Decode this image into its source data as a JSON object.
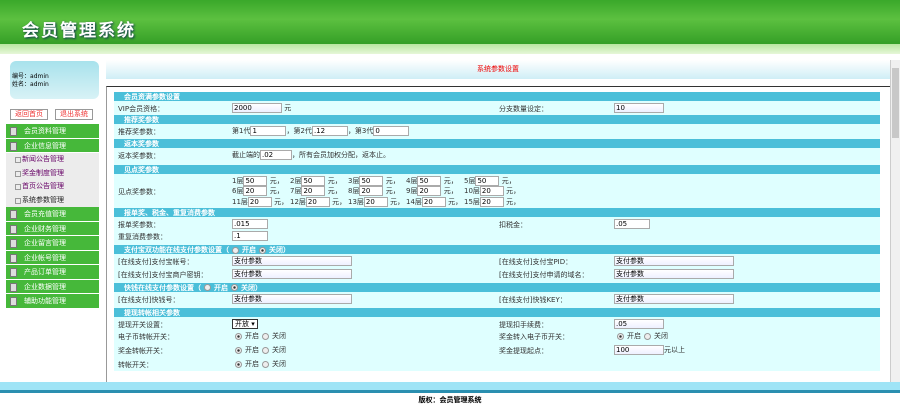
{
  "header": {
    "title": "会员管理系统"
  },
  "user": {
    "id_label": "编号：",
    "id": "admin",
    "name_label": "姓名：",
    "name": "admin"
  },
  "buttons": {
    "home": "返回首页",
    "logout": "退出系统"
  },
  "menu": [
    {
      "label": "会员资料管理"
    },
    {
      "label": "企业信息管理",
      "children": [
        "新闻公告管理",
        "奖金制度管理",
        "首页公告管理",
        "系统参数管理"
      ]
    },
    {
      "label": "会员充值管理"
    },
    {
      "label": "企业财务管理"
    },
    {
      "label": "企业留言管理"
    },
    {
      "label": "企业帐号管理"
    },
    {
      "label": "产品订单管理"
    },
    {
      "label": "企业数据管理"
    },
    {
      "label": "辅助功能管理"
    }
  ],
  "page_title": "系统参数设置",
  "form": {
    "s1": "会员资满参数设置",
    "vip_label": "VIP会员资格：",
    "vip": "2000",
    "yuan": "元",
    "branch_label": "分支数量设定：",
    "branch": "10",
    "s2": "推荐奖参数",
    "rec_label": "推荐奖参数：",
    "g1": "第1代",
    "g1v": "1",
    "g2": "，第2代",
    "g2v": ".12",
    "g3": "，第3代",
    "g3v": "0",
    "s3": "返本奖参数",
    "ret_label": "返本奖参数：",
    "ret_pre": "截止端的",
    "ret_v": ".02",
    "ret_post": "，所有会员加权分配，返本止。",
    "s4": "见点奖参数",
    "pt_label": "见点奖参数：",
    "layers": [
      [
        "1层",
        "50"
      ],
      [
        "2层",
        "50"
      ],
      [
        "3层",
        "50"
      ],
      [
        "4层",
        "50"
      ],
      [
        "5层",
        "50"
      ],
      [
        "6层",
        "20"
      ],
      [
        "7层",
        "20"
      ],
      [
        "8层",
        "20"
      ],
      [
        "9层",
        "20"
      ],
      [
        "10层",
        "20"
      ],
      [
        "11层",
        "20"
      ],
      [
        "12层",
        "20"
      ],
      [
        "13层",
        "20"
      ],
      [
        "14层",
        "20"
      ],
      [
        "15层",
        "20"
      ]
    ],
    "yuan_sep": "元，",
    "s5": "报单奖、税金、重复消费参数",
    "bd_label": "报单奖参数：",
    "bd": ".015",
    "tax_label": "扣税金：",
    "tax": ".05",
    "rep_label": "重复消费参数：",
    "rep": ".1",
    "s6": "支付宝双功能在线支付参数设置（",
    "open": "开启",
    "close": "关闭）",
    "ali_acc_label": "[在线支付]支付宝帐号：",
    "ali_acc": "支付参数",
    "ali_pid_label": "[在线支付]支付宝PID：",
    "ali_pid": "支付参数",
    "ali_key_label": "[在线支付]支付宝商户密钥：",
    "ali_key": "支付参数",
    "ali_dom_label": "[在线支付]支付申请的域名：",
    "ali_dom": "支付参数",
    "s7": "快钱在线支付参数设置（",
    "kq_label": "[在线支付]快钱号：",
    "kq": "支付参数",
    "kq_key_label": "[在线支付]快钱KEY：",
    "kq_key": "支付参数",
    "s8": "提现转帐相关参数",
    "wd_label": "提现开关设置：",
    "wd": "开放",
    "fee_label": "提现扣手续费：",
    "fee": ".05",
    "ec_label": "电子币转帐开关：",
    "to_ec_label": "奖金转入电子币开关：",
    "bonus_tr_label": "奖金转帐开关：",
    "min_label": "奖金提现起点：",
    "min": "100",
    "min_post": "元以上",
    "tr_label": "转帐开关：",
    "on": "开启",
    "off": "关闭"
  },
  "footer": "版权：会员管理系统"
}
